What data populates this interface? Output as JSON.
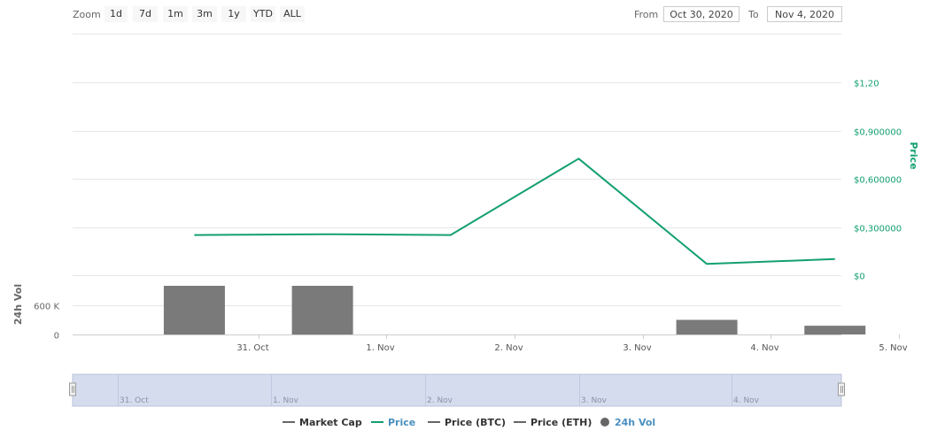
{
  "toolbar": {
    "zoom_label": "Zoom",
    "zoom_buttons": [
      "1d",
      "7d",
      "1m",
      "3m",
      "1y",
      "YTD",
      "ALL"
    ],
    "from_label": "From",
    "from_value": "Oct 30, 2020",
    "to_label": "To",
    "to_value": "Nov 4, 2020"
  },
  "colors": {
    "price": "#13a06f",
    "volume": "#7a7a7a",
    "navigator_fill": "#d5dcee",
    "grid": "#e6e6e6"
  },
  "legend": [
    {
      "label": "Market Cap",
      "color": "#666666",
      "marker": "line"
    },
    {
      "label": "Price",
      "color": "#13a06f",
      "marker": "line",
      "label_color": "#4a8fbf"
    },
    {
      "label": "Price (BTC)",
      "color": "#666666",
      "marker": "line"
    },
    {
      "label": "Price (ETH)",
      "color": "#666666",
      "marker": "line"
    },
    {
      "label": "24h Vol",
      "color": "#666666",
      "marker": "dot",
      "label_color": "#4a8fbf"
    }
  ],
  "chart_data": {
    "type": "line",
    "x_unit": "days (Oct 30 2020 = 0)",
    "price_axis": {
      "title": "Price",
      "ticks": [
        0,
        0.3,
        0.6,
        0.9,
        1.2
      ],
      "tick_labels": [
        "$0",
        "$0,300000",
        "$0,600000",
        "$0,900000",
        "$1,20"
      ],
      "range": [
        0,
        1.2
      ],
      "position": "right"
    },
    "x_axis": {
      "range": [
        0.05,
        6.05
      ],
      "ticks": [
        1.5,
        2.5,
        3.5,
        4.5,
        5.5,
        6.5
      ],
      "tick_labels": [
        "31. Oct",
        "1. Nov",
        "2. Nov",
        "3. Nov",
        "4. Nov",
        "5. Nov"
      ]
    },
    "price_series": {
      "name": "Price",
      "x": [
        1,
        2,
        3,
        4,
        5,
        6
      ],
      "y": [
        0.25,
        0.255,
        0.25,
        0.725,
        0.07,
        0.1
      ]
    },
    "volume_axis": {
      "title": "24h Vol",
      "ticks": [
        0,
        600000
      ],
      "tick_labels": [
        "0",
        "600 K"
      ],
      "range": [
        0,
        1200000
      ],
      "position": "left"
    },
    "volume_series": {
      "name": "24h Vol",
      "x": [
        1,
        2,
        5,
        6
      ],
      "values": [
        1000000,
        1000000,
        300000,
        180000
      ]
    },
    "navigator": {
      "tick_labels": [
        "31. Oct",
        "1. Nov",
        "2. Nov",
        "3. Nov",
        "4. Nov"
      ]
    },
    "grid": true
  }
}
